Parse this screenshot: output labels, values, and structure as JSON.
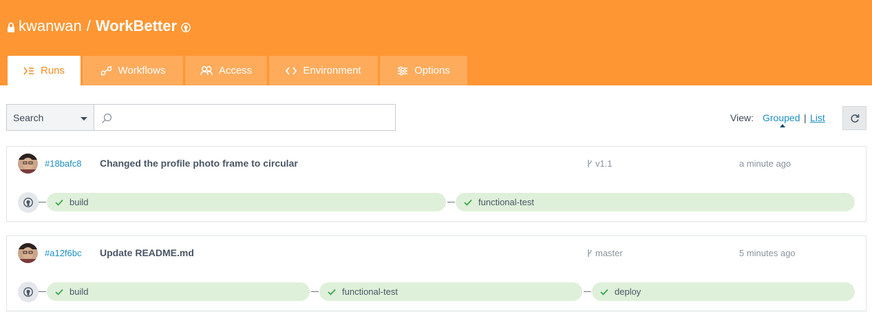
{
  "repo": {
    "owner": "kwanwan",
    "separator": "/",
    "name": "WorkBetter"
  },
  "tabs": [
    {
      "label": "Runs",
      "icon": "runs-icon",
      "active": true
    },
    {
      "label": "Workflows",
      "icon": "workflows-icon"
    },
    {
      "label": "Access",
      "icon": "access-icon"
    },
    {
      "label": "Environment",
      "icon": "code-icon"
    },
    {
      "label": "Options",
      "icon": "sliders-icon"
    }
  ],
  "search": {
    "scope": "Search",
    "value": "",
    "placeholder": ""
  },
  "view": {
    "label": "View:",
    "grouped": "Grouped",
    "separator": "|",
    "list": "List",
    "selected": "Grouped"
  },
  "colors": {
    "header": "#fe9633",
    "tab_inactive": "#ffab5c",
    "link": "#1b8fc3",
    "job_success": "#dff0da",
    "check": "#3aa64a"
  },
  "runs": [
    {
      "sha": "#18bafc8",
      "message": "Changed the profile photo frame to circular",
      "branch": "v1.1",
      "time": "a minute ago",
      "jobs": [
        {
          "name": "build",
          "status": "success"
        },
        {
          "name": "functional-test",
          "status": "success"
        }
      ]
    },
    {
      "sha": "#a12f6bc",
      "message": "Update README.md",
      "branch": "master",
      "time": "5 minutes ago",
      "jobs": [
        {
          "name": "build",
          "status": "success"
        },
        {
          "name": "functional-test",
          "status": "success"
        },
        {
          "name": "deploy",
          "status": "success"
        }
      ]
    }
  ]
}
